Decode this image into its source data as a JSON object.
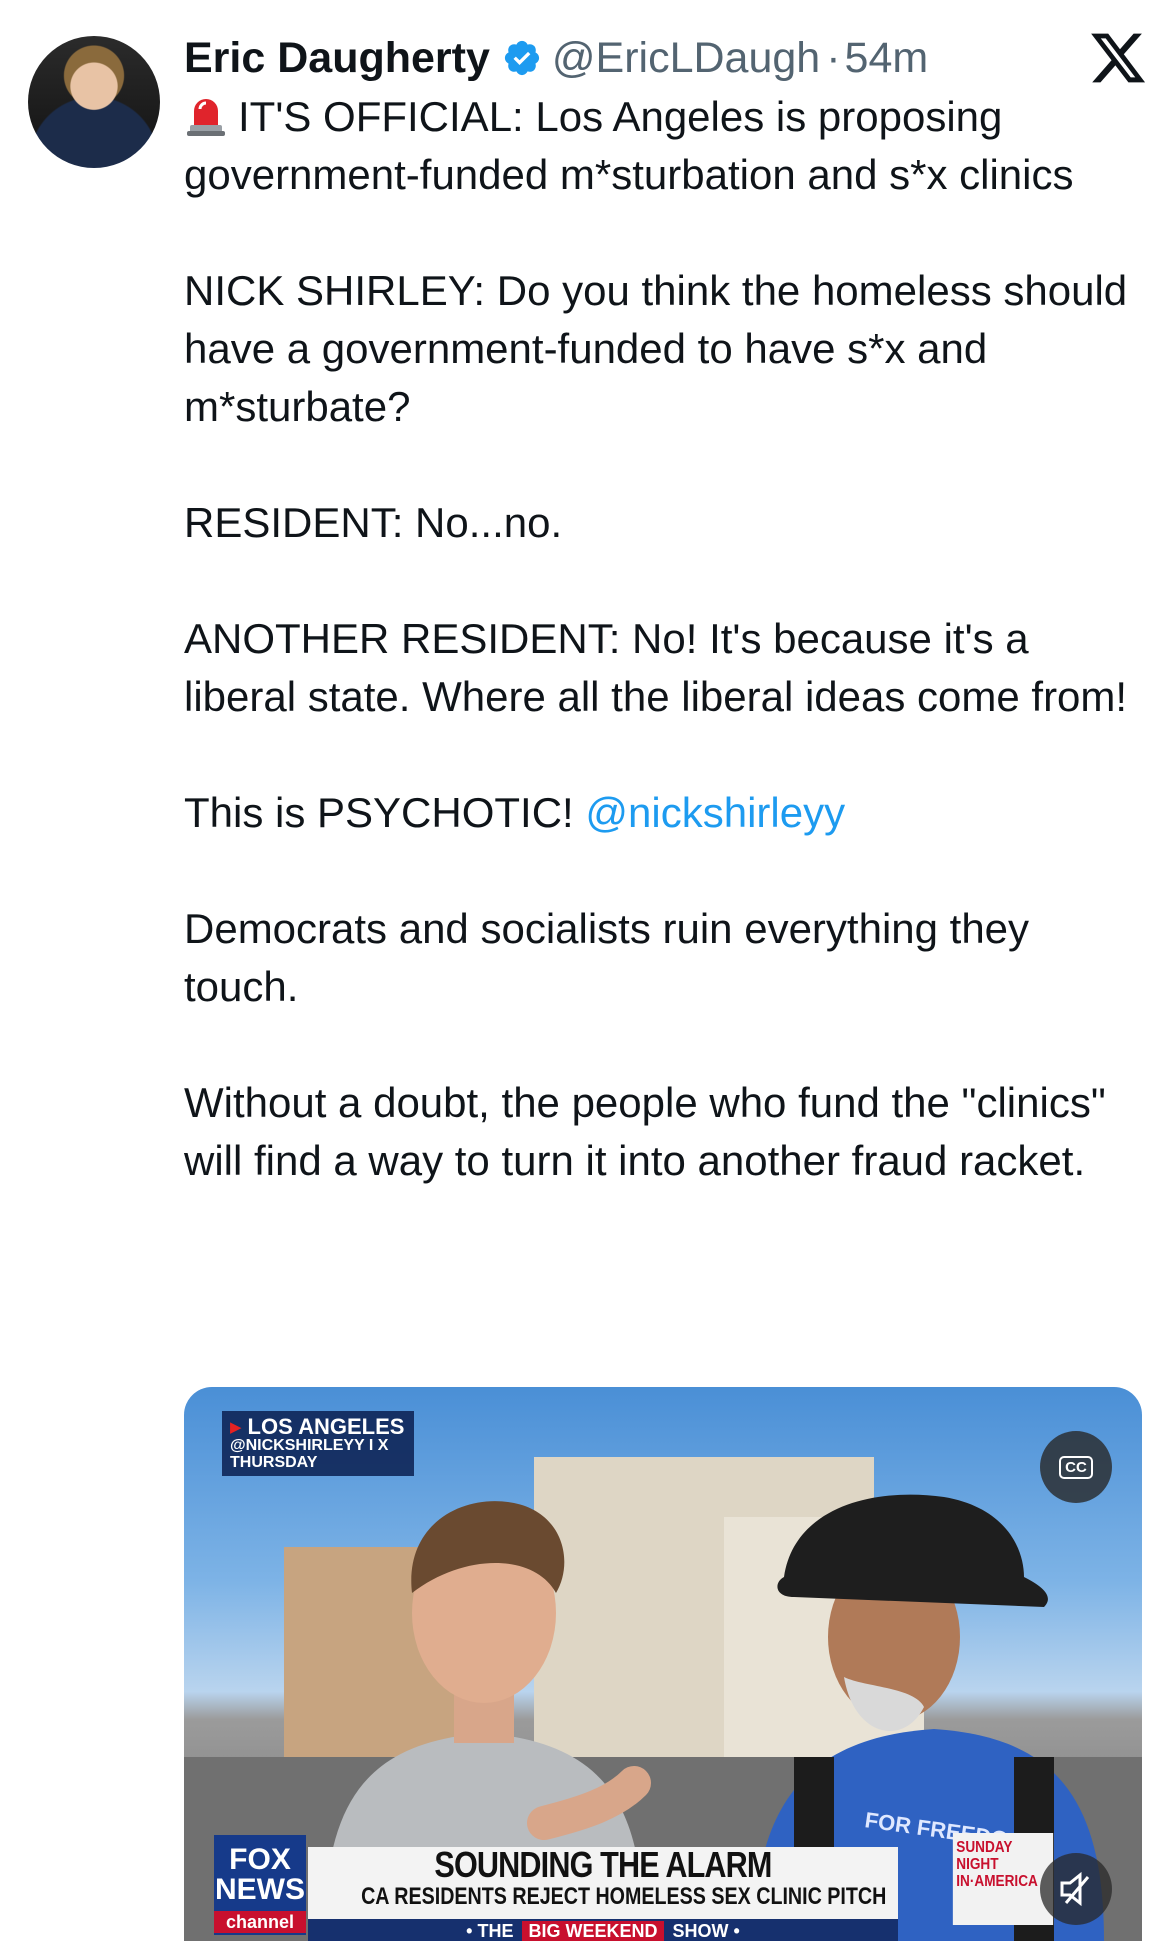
{
  "author": {
    "name": "Eric Daugherty",
    "handle": "@EricLDaugh",
    "separator": "·",
    "timestamp": "54m"
  },
  "tweet": {
    "line1": "IT'S OFFICIAL: Los Angeles is proposing government-funded m*sturbation and s*x clinics",
    "p2": "NICK SHIRLEY: Do you think the homeless should have a government-funded to have s*x and m*sturbate?",
    "p3": "RESIDENT: No...no.",
    "p4": "ANOTHER RESIDENT: No! It's because it's a liberal state. Where all the liberal ideas come from!",
    "p5_text": "This is PSYCHOTIC! ",
    "p5_mention": "@nickshirleyy",
    "p6": "Democrats and socialists ruin everything they touch.",
    "p7": "Without a doubt, the people who fund the \"clinics\" will find a way to turn it into another fraud racket."
  },
  "media": {
    "location": "LOS ANGELES",
    "source": "@NICKSHIRLEYY I X",
    "day": "THURSDAY",
    "cc_label": "CC",
    "network_line1": "FOX",
    "network_line2": "NEWS",
    "network_line3": "channel",
    "headline": "SOUNDING THE ALARM",
    "subheadline": "CA RESIDENTS REJECT HOMELESS SEX CLINIC PITCH",
    "strip_pre": "• THE",
    "strip_big": "BIG WEEKEND",
    "strip_post": "SHOW •",
    "show_name": "SUNDAY NIGHT IN·AMERICA",
    "shirt_text": "FOR FREEDO"
  },
  "icons": {
    "verified": "verified-badge-icon",
    "alarm": "police-light-emoji",
    "platform": "x-logo-icon",
    "cc": "closed-captions-icon",
    "mute": "mute-icon"
  },
  "colors": {
    "mention": "#1d9bf0",
    "verified": "#1d9bf0",
    "handle": "#536471"
  }
}
